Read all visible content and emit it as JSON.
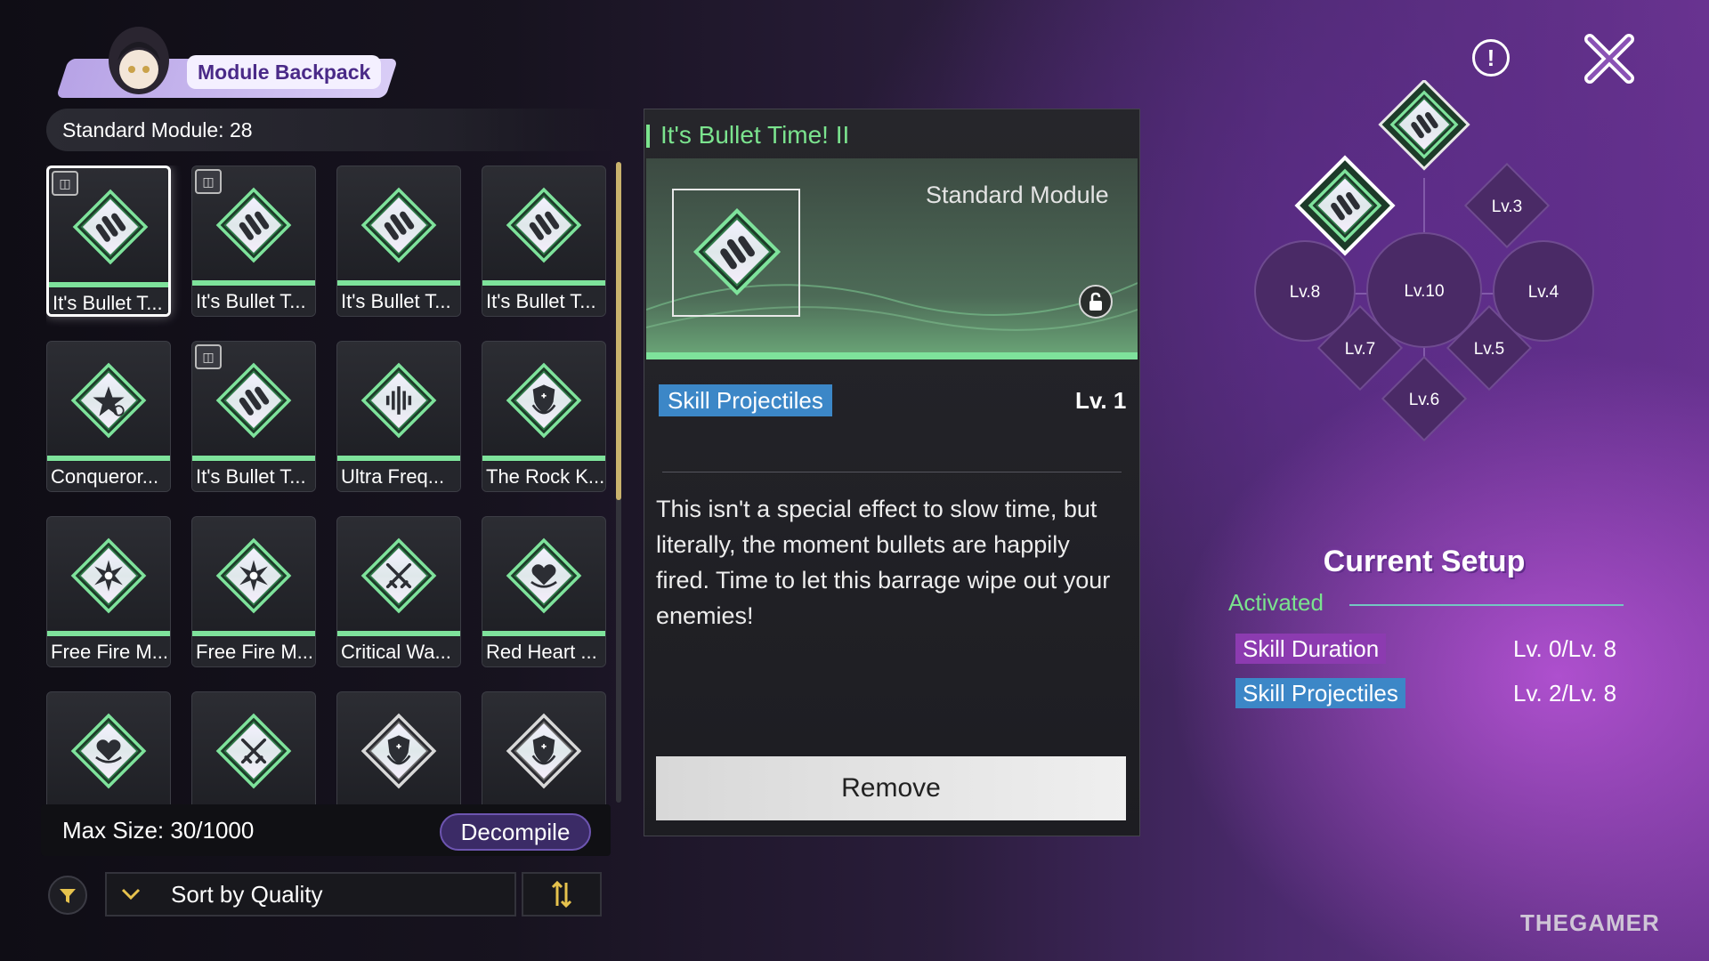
{
  "header": {
    "title": "Module Backpack",
    "standard_module_count": "Standard Module: 28"
  },
  "grid": {
    "items": [
      {
        "label": "It's Bullet T...",
        "icon": "bullets-icon",
        "tag": true
      },
      {
        "label": "It's Bullet T...",
        "icon": "bullets-icon",
        "tag": true
      },
      {
        "label": "It's Bullet T...",
        "icon": "bullets-icon",
        "tag": false
      },
      {
        "label": "It's Bullet T...",
        "icon": "bullets-icon",
        "tag": false
      },
      {
        "label": "Conqueror...",
        "icon": "star-clock-icon",
        "tag": false
      },
      {
        "label": "It's Bullet T...",
        "icon": "bullets-icon",
        "tag": true
      },
      {
        "label": "Ultra Freq...",
        "icon": "soundwave-icon",
        "tag": false
      },
      {
        "label": "The Rock K...",
        "icon": "shield-crescent-icon",
        "tag": false
      },
      {
        "label": "Free Fire M...",
        "icon": "burst-icon",
        "tag": false
      },
      {
        "label": "Free Fire M...",
        "icon": "burst-icon",
        "tag": false
      },
      {
        "label": "Critical Wa...",
        "icon": "crossed-swords-icon",
        "tag": false
      },
      {
        "label": "Red Heart ...",
        "icon": "heart-hand-icon",
        "tag": false
      },
      {
        "label": "",
        "icon": "heart-hand-icon",
        "tag": false
      },
      {
        "label": "",
        "icon": "crossed-swords-icon",
        "tag": false
      },
      {
        "label": "",
        "icon": "shield-crescent-icon",
        "tag": false
      },
      {
        "label": "",
        "icon": "shield-crescent-icon",
        "tag": false
      }
    ]
  },
  "footer": {
    "max_size": "Max Size: 30/1000",
    "decompile_label": "Decompile",
    "sort_label": "Sort by Quality"
  },
  "detail": {
    "title": "It's Bullet Time! II",
    "type": "Standard Module",
    "skill_tag": "Skill Projectiles",
    "level": "Lv. 1",
    "description": "This isn't a special effect to slow time, but literally, the moment bullets are happily fired. Time to let this barrage wipe out your enemies!",
    "remove_label": "Remove"
  },
  "slots": {
    "lv3": "Lv.3",
    "lv4": "Lv.4",
    "lv5": "Lv.5",
    "lv6": "Lv.6",
    "lv7": "Lv.7",
    "lv8": "Lv.8",
    "lv10": "Lv.10"
  },
  "setup": {
    "title": "Current Setup",
    "activated": "Activated",
    "rows": [
      {
        "name": "Skill Duration",
        "level": "Lv. 0/Lv. 8",
        "color": "#8c3bb0"
      },
      {
        "name": "Skill Projectiles",
        "level": "Lv. 2/Lv. 8",
        "color": "#3c87c7"
      }
    ]
  },
  "watermark": "THEGAMER",
  "colors": {
    "accent_green": "#7be38e",
    "skill_blue": "#3c87c7",
    "skill_purple": "#8c3bb0"
  }
}
